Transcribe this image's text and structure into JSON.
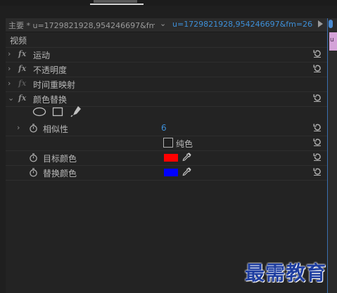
{
  "header": {
    "source_label": "主要 * u=1729821928,954246697&fm=...",
    "clip_label": "u=1729821928,954246697&fm=26&...",
    "chevron_glyph": "⌄"
  },
  "glyphs": {
    "chevron_right": "›",
    "chevron_down": "⌄",
    "fx": "fx"
  },
  "section_video": {
    "label": "视频"
  },
  "effects": [
    {
      "label": "运动",
      "expanded": false,
      "icon": "fx-icon"
    },
    {
      "label": "不透明度",
      "expanded": false,
      "icon": "fx-icon"
    },
    {
      "label": "时间重映射",
      "expanded": false,
      "icon": "fx-icon-disabled"
    },
    {
      "label": "颜色替换",
      "expanded": true,
      "icon": "fx-icon"
    }
  ],
  "color_replace": {
    "tools": [
      "ellipse-mask-icon",
      "rectangle-mask-icon",
      "pen-mask-icon"
    ],
    "similarity": {
      "label": "相似性",
      "value": "6"
    },
    "solid_colors": {
      "label": "纯色",
      "checked": false
    },
    "target_color": {
      "label": "目标颜色",
      "color": "#ff0000"
    },
    "replace_color": {
      "label": "替换颜色",
      "color": "#0000ff"
    }
  },
  "timeline_clip": {
    "label": "u"
  },
  "watermark": {
    "text": "最需教育"
  },
  "colors": {
    "accent": "#3d8fd8",
    "panel": "#232323",
    "clip": "#d4a3d8"
  }
}
